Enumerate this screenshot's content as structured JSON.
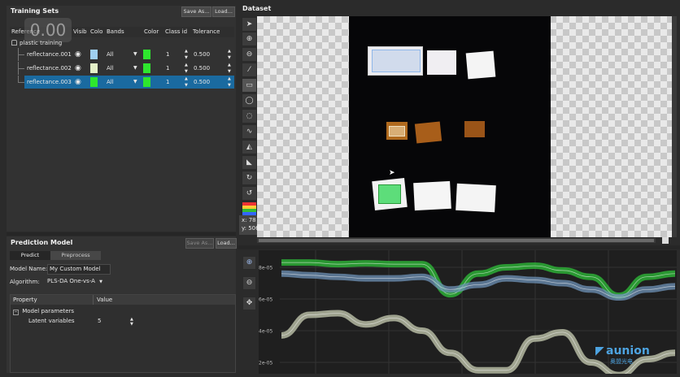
{
  "training_sets": {
    "title": "Training Sets",
    "save_as_label": "Save As...",
    "load_label": "Load...",
    "columns": [
      "Reference",
      "Visib",
      "Colo",
      "Bands",
      "Color",
      "Class id",
      "Tolerance"
    ],
    "root_label": "plastic training",
    "overlay_number": "0.00",
    "rows": [
      {
        "name": "reflectance.001",
        "band": "All",
        "class_id": "1",
        "tolerance": "0.500",
        "swatch": "#9fd0f0",
        "color": "#2ee62e",
        "selected": false
      },
      {
        "name": "reflectance.002",
        "band": "All",
        "class_id": "1",
        "tolerance": "0.500",
        "swatch": "#e4f0c8",
        "color": "#2ee62e",
        "selected": false
      },
      {
        "name": "reflectance.003",
        "band": "All",
        "class_id": "1",
        "tolerance": "0.500",
        "swatch": "#2ee62e",
        "color": "#2ee62e",
        "selected": true
      }
    ]
  },
  "prediction_model": {
    "title": "Prediction Model",
    "save_as_label": "Save As...",
    "load_label": "Load...",
    "tabs": [
      "Predict",
      "Preprocess"
    ],
    "model_name_label": "Model Name:",
    "model_name_value": "My Custom Model",
    "algorithm_label": "Algorithm:",
    "algorithm_value": "PLS-DA One-vs-A",
    "table_headers": [
      "Property",
      "Value"
    ],
    "group_label": "Model parameters",
    "param_label": "Latent variables",
    "param_value": "5"
  },
  "dataset": {
    "title": "Dataset",
    "coord_x": "x: 78",
    "coord_y": "y: 506"
  },
  "chart_data": {
    "type": "line",
    "y_tick_labels": [
      "8e-05",
      "6e-05",
      "4e-05",
      "2e-05"
    ],
    "series": [
      {
        "color": "#2fc23a",
        "values": [
          8.3e-05,
          8.3e-05,
          8.2e-05,
          8.25e-05,
          8.2e-05,
          8.2e-05,
          6.3e-05,
          7.6e-05,
          8e-05,
          8.1e-05,
          7.8e-05,
          7.4e-05,
          6.2e-05,
          7.4e-05,
          7.6e-05
        ]
      },
      {
        "color": "#6f93b8",
        "values": [
          7.6e-05,
          7.5e-05,
          7.4e-05,
          7.3e-05,
          7.3e-05,
          7.4e-05,
          6.6e-05,
          6.9e-05,
          7.3e-05,
          7.2e-05,
          7e-05,
          6.6e-05,
          6.1e-05,
          6.6e-05,
          6.8e-05
        ]
      },
      {
        "color": "#c9cfb4",
        "values": [
          3.7e-05,
          5e-05,
          5.1e-05,
          4.4e-05,
          4.8e-05,
          4e-05,
          2.6e-05,
          1.5e-05,
          1.5e-05,
          3.5e-05,
          3.9e-05,
          2e-05,
          1.2e-05,
          2.2e-05,
          2.6e-05
        ]
      }
    ]
  },
  "watermark": {
    "brand": "aunion",
    "sub": "奥盟光电"
  }
}
